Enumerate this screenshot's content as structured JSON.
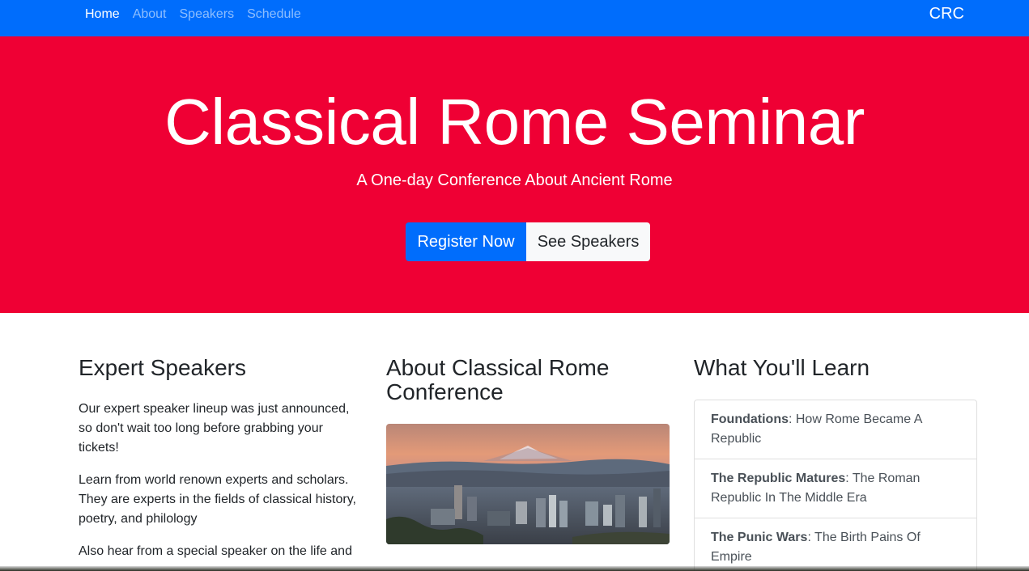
{
  "nav": {
    "links": [
      "Home",
      "About",
      "Speakers",
      "Schedule"
    ],
    "brand": "CRC"
  },
  "hero": {
    "title": "Classical Rome Seminar",
    "subtitle": "A One-day Conference About Ancient Rome",
    "primary_button": "Register Now",
    "secondary_button": "See Speakers"
  },
  "speakers": {
    "heading": "Expert Speakers",
    "paragraphs": [
      "Our expert speaker lineup was just announced, so don't wait too long before grabbing your tickets!",
      "Learn from world renown experts and scholars. They are experts in the fields of classical history, poetry, and philology",
      "Also hear from a special speaker on the life and"
    ]
  },
  "about": {
    "heading": "About Classical Rome Conference"
  },
  "learn": {
    "heading": "What You'll Learn",
    "items": [
      {
        "title": "Foundations",
        "text": ": How Rome Became A Republic"
      },
      {
        "title": "The Republic Matures",
        "text": ": The Roman Republic In The Middle Era"
      },
      {
        "title": "The Punic Wars",
        "text": ": The Birth Pains Of Empire"
      }
    ]
  },
  "colors": {
    "primary": "#006dfc",
    "hero_bg": "#ef0034",
    "light": "#f8f9fa"
  }
}
